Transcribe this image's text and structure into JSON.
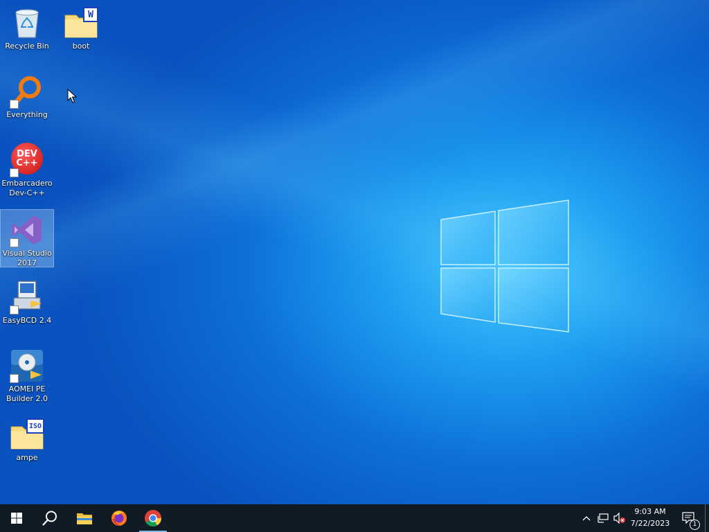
{
  "desktop": {
    "icons": [
      {
        "label": "Recycle Bin"
      },
      {
        "label": "boot"
      },
      {
        "label": "Everything"
      },
      {
        "label": "Embarcadero\nDev-C++"
      },
      {
        "label": "Visual Studio\n2017"
      },
      {
        "label": "EasyBCD 2.4"
      },
      {
        "label": "AOMEI PE\nBuilder 2.0"
      },
      {
        "label": "ampe"
      }
    ],
    "icon_glyphs": {
      "boot": "W",
      "ampe": "ISO",
      "devcpp_line1": "DEV",
      "devcpp_line2": "C++"
    }
  },
  "taskbar": {
    "buttons": [
      {
        "name": "start",
        "icon": "windows-logo-icon"
      },
      {
        "name": "search",
        "icon": "search-icon"
      },
      {
        "name": "file-explorer",
        "icon": "folder-icon"
      },
      {
        "name": "firefox",
        "icon": "firefox-icon"
      },
      {
        "name": "chrome",
        "icon": "chrome-icon",
        "active": true
      }
    ],
    "tray": {
      "time": "9:03 AM",
      "date": "7/22/2023",
      "notification_count": "1"
    }
  },
  "colors": {
    "taskbar": "#101b26",
    "desktop_dark": "#0a52bf",
    "desktop_light": "#48c8ff"
  }
}
